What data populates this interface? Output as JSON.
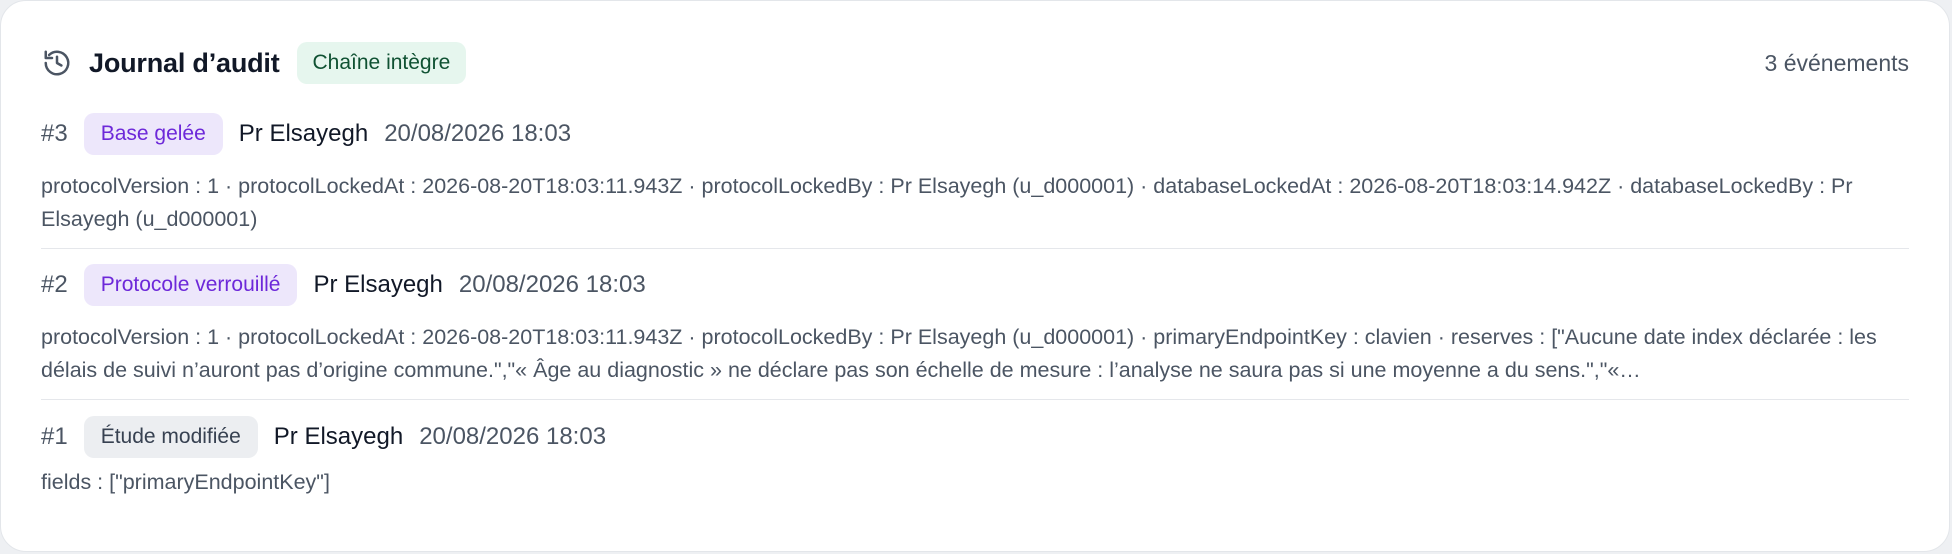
{
  "header": {
    "icon": "history-icon",
    "title": "Journal d’audit",
    "integrity_badge": "Chaîne intègre",
    "event_count": "3 événements"
  },
  "colors": {
    "integrity_bg": "#e6f6ee",
    "integrity_text": "#0f5132",
    "purple_badge_bg": "#ede7fb",
    "purple_badge_text": "#6d28d9",
    "gray_badge_bg": "#eceef1",
    "gray_badge_text": "#374151"
  },
  "entries": [
    {
      "seq": "#3",
      "type": "Base gelée",
      "badge_style": "purple",
      "actor": "Pr Elsayegh",
      "time": "20/08/2026 18:03",
      "details": "protocolVersion : 1 · protocolLockedAt : 2026-08-20T18:03:11.943Z · protocolLockedBy : Pr Elsayegh (u_d000001) · databaseLockedAt : 2026-08-20T18:03:14.942Z · databaseLockedBy : Pr Elsayegh (u_d000001)"
    },
    {
      "seq": "#2",
      "type": "Protocole verrouillé",
      "badge_style": "purple",
      "actor": "Pr Elsayegh",
      "time": "20/08/2026 18:03",
      "details": "protocolVersion : 1 · protocolLockedAt : 2026-08-20T18:03:11.943Z · protocolLockedBy : Pr Elsayegh (u_d000001) · primaryEndpointKey : clavien · reserves : [\"Aucune date index déclarée : les délais de suivi n’auront pas d’origine commune.\",\"« Âge au diagnostic » ne déclare pas son échelle de mesure : l’analyse ne saura pas si une moyenne a du sens.\",\"«…"
    },
    {
      "seq": "#1",
      "type": "Étude modifiée",
      "badge_style": "gray",
      "actor": "Pr Elsayegh",
      "time": "20/08/2026 18:03",
      "details": "fields : [\"primaryEndpointKey\"]"
    }
  ]
}
